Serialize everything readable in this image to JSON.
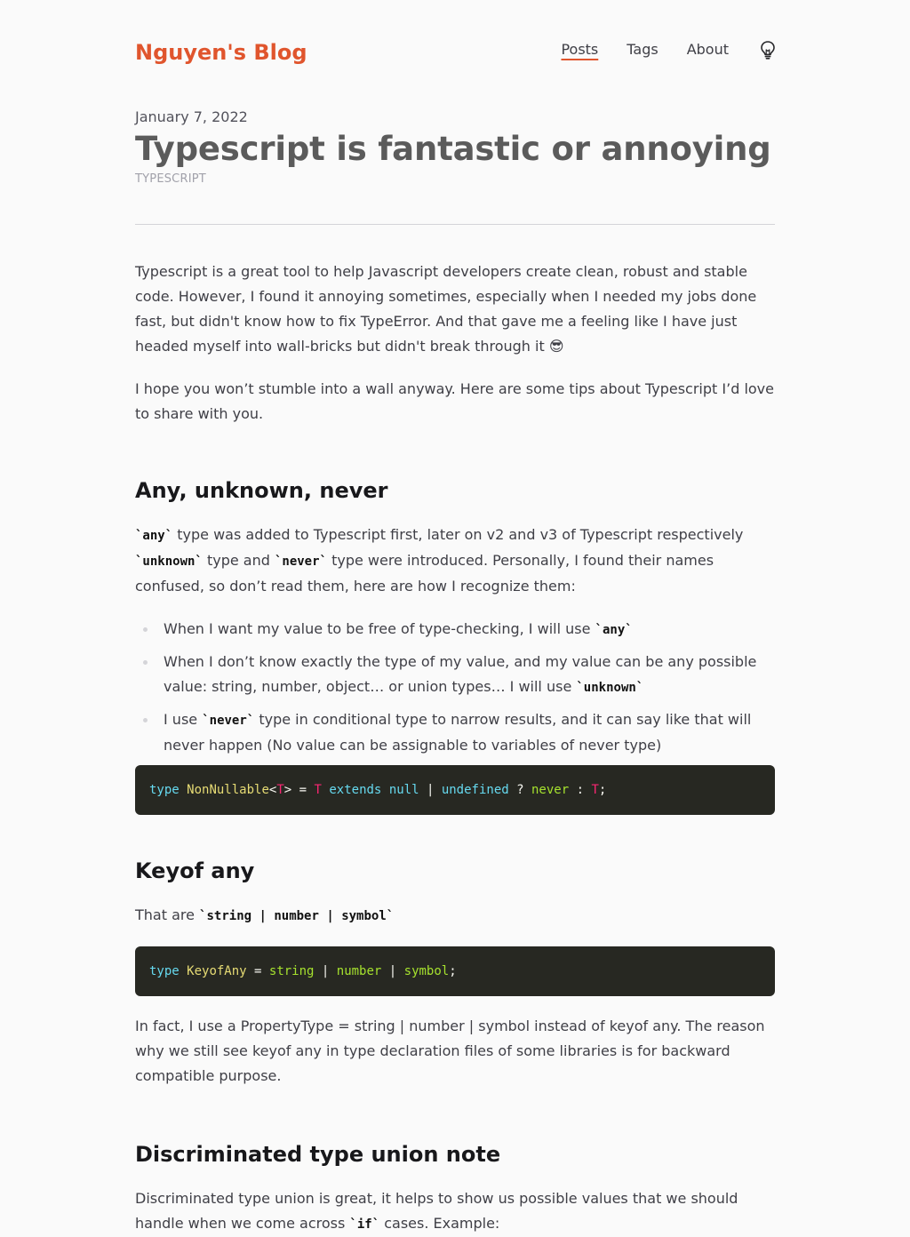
{
  "header": {
    "site_title": "Nguyen's Blog",
    "nav": [
      {
        "label": "Posts",
        "active": true
      },
      {
        "label": "Tags",
        "active": false
      },
      {
        "label": "About",
        "active": false
      }
    ],
    "theme_icon": "lightbulb-icon"
  },
  "post": {
    "date": "January 7, 2022",
    "title": "Typescript is fantastic or annoying",
    "tag": "TYPESCRIPT"
  },
  "content": {
    "intro_p1": "Typescript is a great tool to help Javascript developers create clean, robust and stable code. However, I found it annoying sometimes, especially when I needed my jobs done fast, but didn't know how to fix TypeError. And that gave me a feeling like I have just headed myself into wall-bricks but didn't break through it 😎",
    "intro_p2": "I hope you won’t stumble into a wall anyway. Here are some tips about Typescript I’d love to share with you.",
    "section1": {
      "heading": "Any, unknown, never",
      "p_code_any": "`any`",
      "p_text1": " type was added to Typescript first, later on v2 and v3 of Typescript respectively ",
      "p_code_unknown": "`unknown`",
      "p_text2": " type and ",
      "p_code_never": "`never`",
      "p_text3": " type were introduced. Personally, I found their names confused, so don’t read them, here are how I recognize them:",
      "bullets": [
        {
          "text": "When I want my value to be free of type-checking, I will use ",
          "code": "`any`",
          "tail": ""
        },
        {
          "text": "When I don’t know exactly the type of my value, and my value can be any possible value: string, number, object… or union types… I will use ",
          "code": "`unknown`",
          "tail": ""
        },
        {
          "text": "I use ",
          "code": "`never`",
          "tail": " type in conditional type to narrow results, and it can say like that will never happen (No value can be assignable to variables of never type)"
        }
      ],
      "code_tokens": [
        "type",
        " ",
        "NonNullable",
        "<",
        "T",
        ">",
        " = ",
        "T",
        " ",
        "extends",
        " ",
        "null",
        " | ",
        "undefined",
        " ? ",
        "never",
        " : ",
        "T",
        ";"
      ]
    },
    "section2": {
      "heading": "Keyof any",
      "p_text": "That are ",
      "p_code": "`string | number | symbol`",
      "code_tokens": [
        "type",
        " ",
        "KeyofAny",
        " = ",
        "string",
        " | ",
        "number",
        " | ",
        "symbol",
        ";"
      ],
      "p_after": "In fact, I use a PropertyType = string | number | symbol instead of keyof any. The reason why we still see keyof any in type declaration files of some libraries is for backward compatible purpose."
    },
    "section3": {
      "heading": "Discriminated type union note",
      "p_text1": "Discriminated type union is great, it helps to show us possible values that we should handle when we come across ",
      "p_code": "`if`",
      "p_text2": " cases. Example:"
    }
  },
  "colors": {
    "accent": "#e0552d",
    "code_bg": "#272822"
  }
}
